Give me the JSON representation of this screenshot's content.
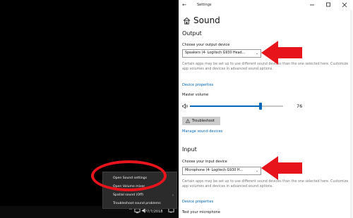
{
  "taskbar": {
    "clock_date": "7/7/2018"
  },
  "context_menu": {
    "items": [
      {
        "label": "Open Sound settings"
      },
      {
        "label": "Open Volume mixer"
      },
      {
        "label": "Spatial sound (Off)"
      },
      {
        "label": "Troubleshoot sound problems"
      }
    ]
  },
  "settings": {
    "window_title": "Settings",
    "page_title": "Sound",
    "output": {
      "heading": "Output",
      "device_label": "Choose your output device",
      "device_value": "Speakers (4- Logitech G930 Head...",
      "info": "Certain apps may be set up to use different sound devices than the one selected here. Customize app volumes and devices in advanced sound options.",
      "device_properties_link": "Device properties",
      "master_volume_label": "Master volume",
      "volume_value": "76",
      "volume_level": 76,
      "troubleshoot_label": "Troubleshoot",
      "manage_link": "Manage sound devices"
    },
    "input": {
      "heading": "Input",
      "device_label": "Choose your input device",
      "device_value": "Microphone (4- Logitech G930 H...",
      "info": "Certain apps may be set up to use different sound devices than the one selected here. Customize app volumes and devices in advanced sound options.",
      "device_properties_link": "Device properties",
      "test_label": "Test your microphone"
    }
  },
  "colors": {
    "accent": "#0067b8",
    "annotation_red": "#e8141c",
    "menu_background": "#2b2b2b"
  }
}
